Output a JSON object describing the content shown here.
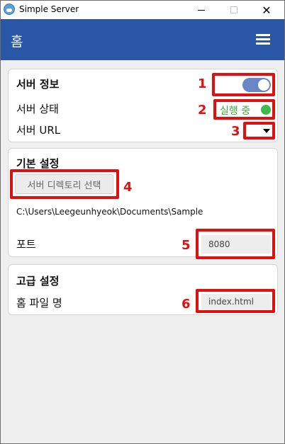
{
  "window": {
    "title": "Simple Server",
    "minimize": "",
    "maximize": "",
    "close": "✕"
  },
  "appbar": {
    "title": "홈",
    "menu_icon": "hamburger-menu-icon"
  },
  "server_info": {
    "title": "서버 정보",
    "status_label": "서버 상태",
    "status_value": "실행 중",
    "url_label": "서버 URL",
    "toggle_on": true,
    "status_color": "#42b84a"
  },
  "basic_settings": {
    "title": "기본 설정",
    "dir_button": "서버 디렉토리 선택",
    "dir_path": "C:\\Users\\Leegeunhyeok\\Documents\\Sample",
    "port_label": "포트",
    "port_value": "8080"
  },
  "advanced_settings": {
    "title": "고급 설정",
    "home_file_label": "홈 파일 명",
    "home_file_value": "index.html"
  },
  "annotations": {
    "m1": "1",
    "m2": "2",
    "m3": "3",
    "m4": "4",
    "m5": "5",
    "m6": "6"
  },
  "colors": {
    "header": "#2a56a8",
    "annotation": "#e01010",
    "toggle": "#6a86c4"
  }
}
